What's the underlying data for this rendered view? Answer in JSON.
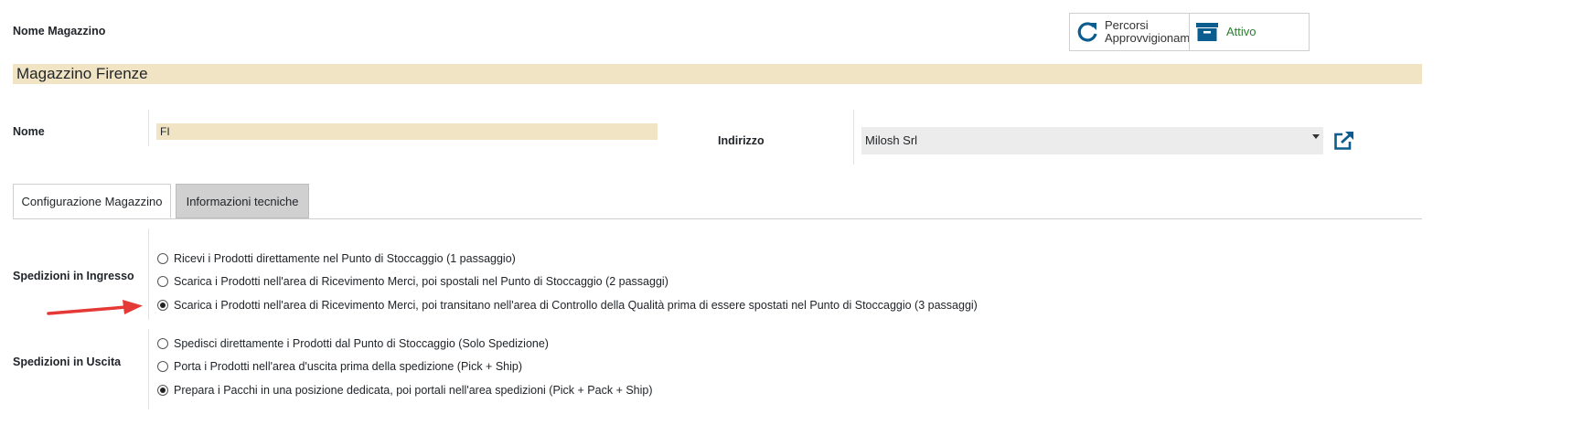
{
  "header": {
    "field_label": "Nome Magazzino",
    "buttons": {
      "routes_label_line1": "Percorsi",
      "routes_label_line2": "Approvvigionam",
      "active_label": "Attivo"
    }
  },
  "warehouse": {
    "name": "Magazzino Firenze"
  },
  "fields": {
    "nome_label": "Nome",
    "nome_value": "FI",
    "indirizzo_label": "Indirizzo",
    "indirizzo_value": "Milosh Srl"
  },
  "tabs": [
    {
      "label": "Configurazione Magazzino",
      "active": true
    },
    {
      "label": "Informazioni tecniche",
      "active": false
    }
  ],
  "incoming": {
    "label": "Spedizioni in Ingresso",
    "options": [
      {
        "label": "Ricevi i Prodotti direttamente nel Punto di Stoccaggio (1 passaggio)",
        "selected": false
      },
      {
        "label": "Scarica i Prodotti nell'area di Ricevimento Merci, poi spostali nel Punto di Stoccaggio (2 passaggi)",
        "selected": false
      },
      {
        "label": "Scarica i Prodotti nell'area di Ricevimento Merci, poi transitano nell'area di Controllo della Qualità prima di essere spostati nel Punto di Stoccaggio (3 passaggi)",
        "selected": true
      }
    ]
  },
  "outgoing": {
    "label": "Spedizioni in Uscita",
    "options": [
      {
        "label": "Spedisci direttamente i Prodotti dal Punto di Stoccaggio (Solo Spedizione)",
        "selected": false
      },
      {
        "label": "Porta i Prodotti nell'area d'uscita prima della spedizione (Pick + Ship)",
        "selected": false
      },
      {
        "label": "Prepara i Pacchi in una posizione dedicata, poi portali nell'area spedizioni (Pick + Pack + Ship)",
        "selected": true
      }
    ]
  },
  "colors": {
    "accent_blue": "#0b5c8f",
    "active_green": "#2e7d32",
    "highlight_bg": "#f1e4c4",
    "annotation_arrow": "#e53935"
  },
  "icons": {
    "routes": "refresh-icon",
    "active": "archive-icon",
    "external_link": "external-link-icon",
    "dropdown": "caret-down-icon"
  }
}
